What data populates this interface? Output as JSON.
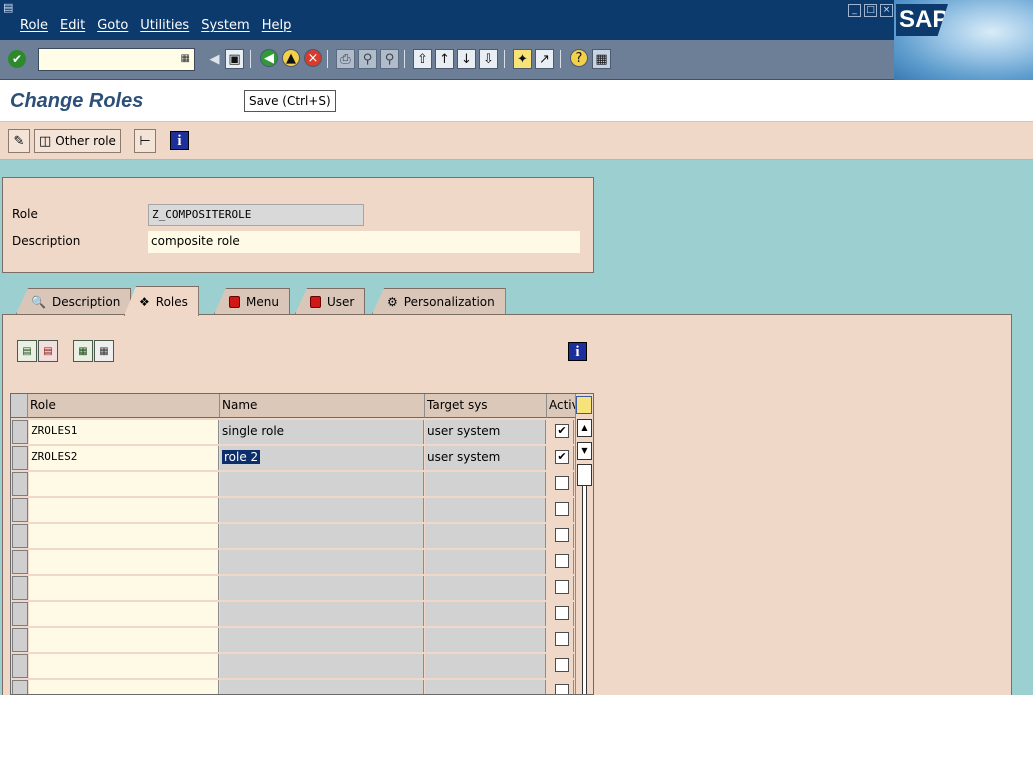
{
  "menu": {
    "items": [
      "Role",
      "Edit",
      "Goto",
      "Utilities",
      "System",
      "Help"
    ]
  },
  "logo": {
    "text": "SAP"
  },
  "stdbar": {
    "command_value": ""
  },
  "title": {
    "text": "Change Roles"
  },
  "tooltip": {
    "text": "Save  (Ctrl+S)"
  },
  "appbar": {
    "other_role_label": "Other role"
  },
  "header": {
    "role_label": "Role",
    "role_value": "Z_COMPOSITEROLE",
    "desc_label": "Description",
    "desc_value": "composite role"
  },
  "tabs": [
    {
      "label": "Description",
      "active": false
    },
    {
      "label": "Roles",
      "active": true
    },
    {
      "label": "Menu",
      "active": false
    },
    {
      "label": "User",
      "active": false
    },
    {
      "label": "Personalization",
      "active": false
    }
  ],
  "table": {
    "columns": [
      "Role",
      "Name",
      "Target sys",
      "Activ"
    ],
    "rows": [
      {
        "role": "ZROLES1",
        "name": "single role",
        "target": "user system",
        "active": true
      },
      {
        "role": "ZROLES2",
        "name": "role 2",
        "target": "user system",
        "active": true
      },
      {
        "role": "",
        "name": "",
        "target": "",
        "active": false
      },
      {
        "role": "",
        "name": "",
        "target": "",
        "active": false
      },
      {
        "role": "",
        "name": "",
        "target": "",
        "active": false
      },
      {
        "role": "",
        "name": "",
        "target": "",
        "active": false
      },
      {
        "role": "",
        "name": "",
        "target": "",
        "active": false
      },
      {
        "role": "",
        "name": "",
        "target": "",
        "active": false
      },
      {
        "role": "",
        "name": "",
        "target": "",
        "active": false
      },
      {
        "role": "",
        "name": "",
        "target": "",
        "active": false
      },
      {
        "role": "",
        "name": "",
        "target": "",
        "active": false
      }
    ]
  },
  "colors": {
    "menubar": "#0c3a6c",
    "toolbar": "#6d7f97",
    "workarea": "#9ccfcf",
    "panel": "#f0d8c8",
    "title": "#2c5078"
  }
}
